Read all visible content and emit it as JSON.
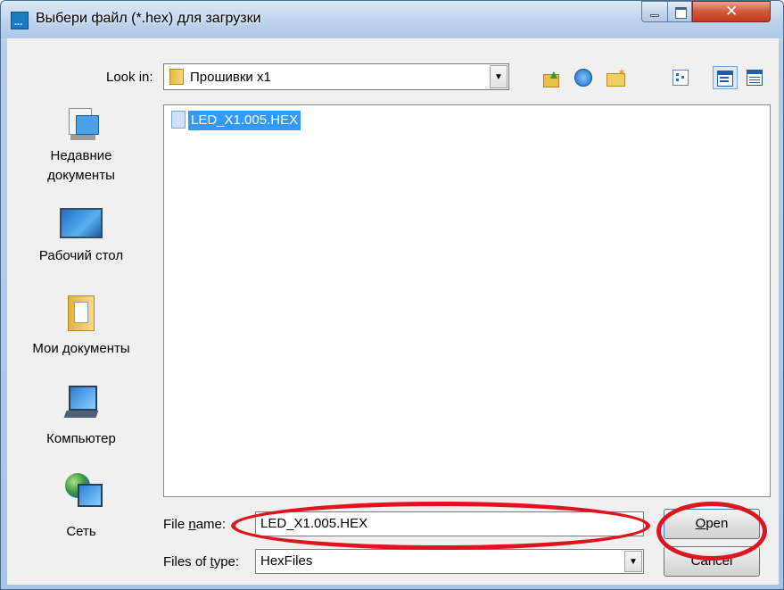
{
  "window": {
    "title": "Выбери файл (*.hex) для загрузки",
    "app_icon_glyph": "..."
  },
  "toolbar": {
    "look_in_label": "Look in:",
    "look_in_value": "Прошивки x1",
    "icons": [
      "up-folder-icon",
      "back-icon",
      "new-folder-icon",
      "list-view-icon",
      "details-view-icon",
      "thumbnail-view-icon"
    ]
  },
  "places": [
    {
      "label_line1": "Недавние",
      "label_line2": "документы",
      "icon": "recent-documents-icon"
    },
    {
      "label_line1": "Рабочий стол",
      "label_line2": "",
      "icon": "desktop-icon"
    },
    {
      "label_line1": "Мои документы",
      "label_line2": "",
      "icon": "my-documents-icon"
    },
    {
      "label_line1": "Компьютер",
      "label_line2": "",
      "icon": "computer-icon"
    },
    {
      "label_line1": "Сеть",
      "label_line2": "",
      "icon": "network-icon"
    }
  ],
  "files": [
    {
      "name": "LED_X1.005.HEX",
      "selected": true
    }
  ],
  "form": {
    "file_name_label": "File name:",
    "file_name_value": "LED_X1.005.HEX",
    "files_of_type_label": "Files of type:",
    "files_of_type_value": "HexFiles",
    "open_label": "Open",
    "cancel_label": "Cancel"
  },
  "colors": {
    "annotation_ring": "#e0141e",
    "selection": "#3399ff",
    "close_button": "#c5391b"
  }
}
